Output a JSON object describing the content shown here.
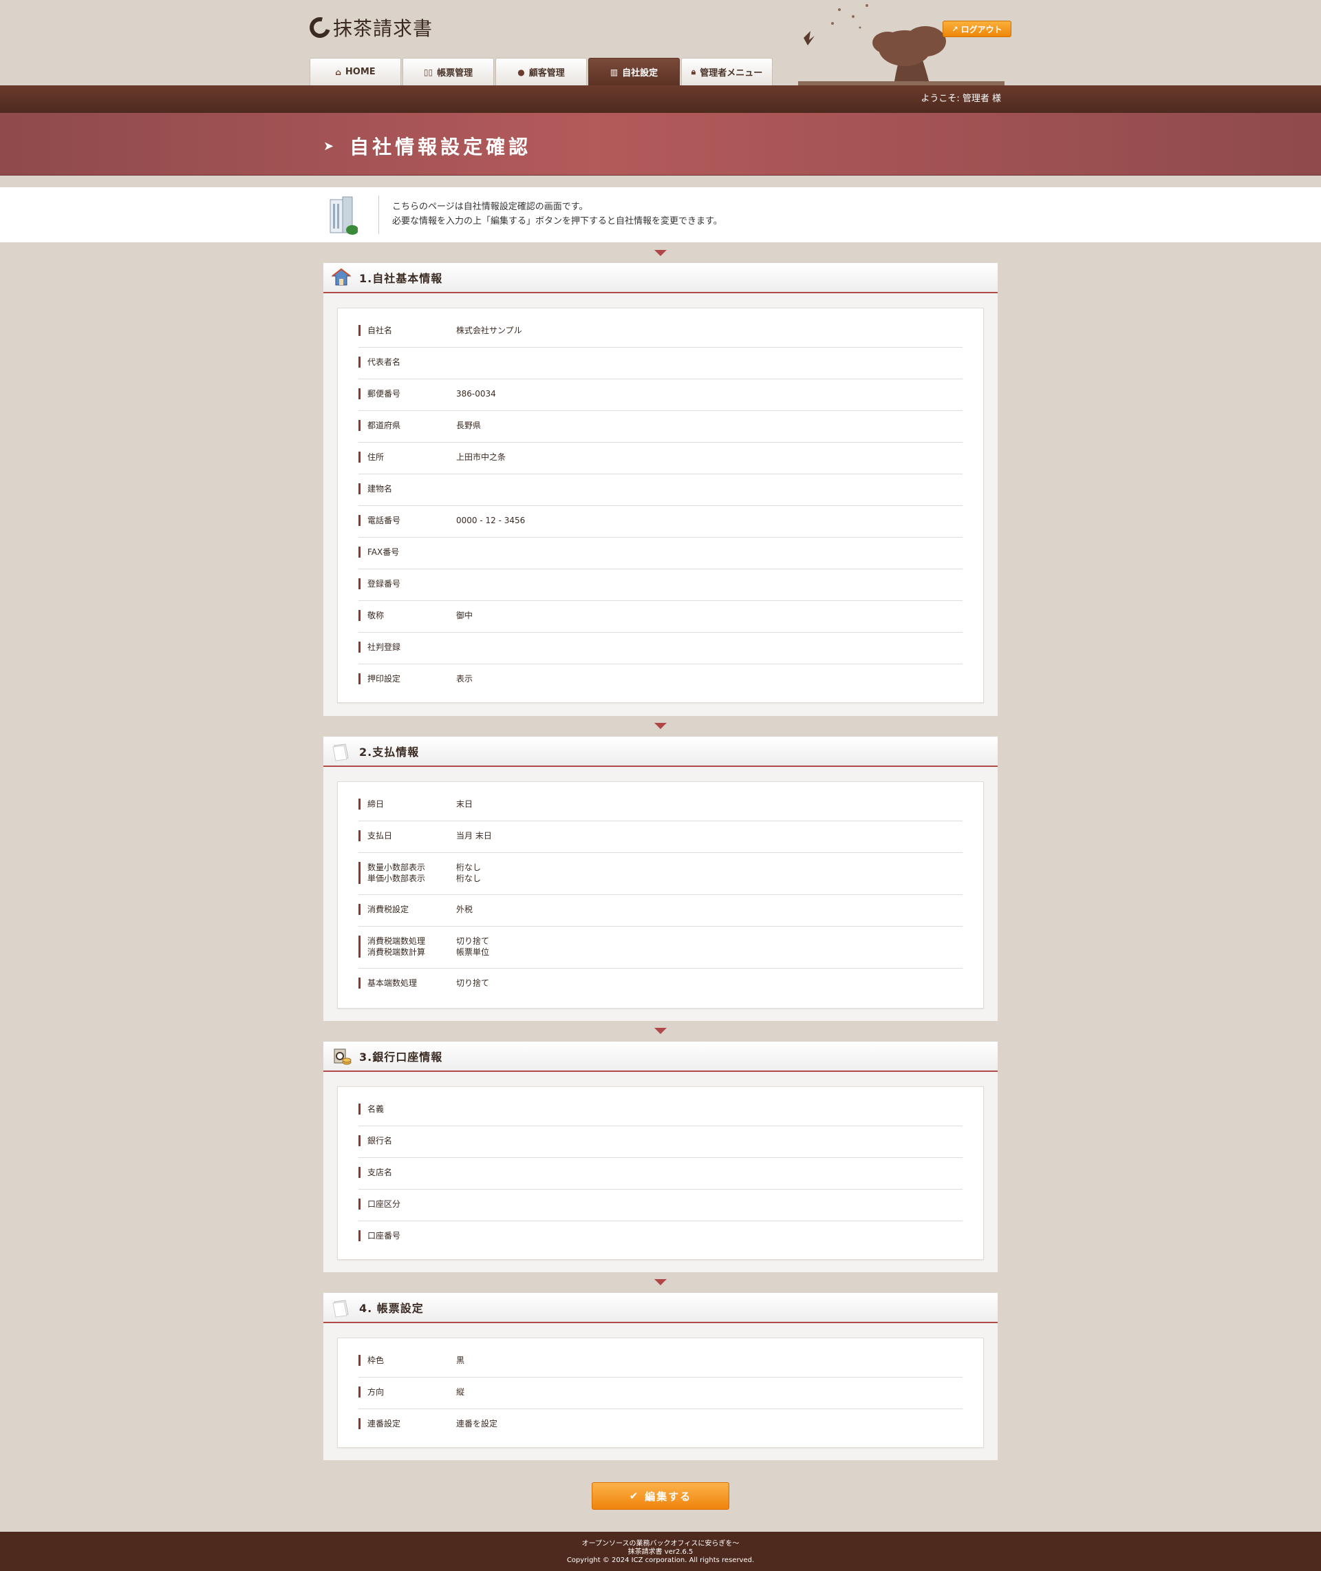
{
  "header": {
    "logo_text": "抹茶請求書",
    "logout_label": "ログアウト",
    "tabs": [
      {
        "label": "HOME",
        "icon": "home-icon",
        "active": false
      },
      {
        "label": "帳票管理",
        "icon": "book-icon",
        "active": false
      },
      {
        "label": "顧客管理",
        "icon": "person-icon",
        "active": false
      },
      {
        "label": "自社設定",
        "icon": "building-icon",
        "active": true
      },
      {
        "label": "管理者メニュー",
        "icon": "lock-icon",
        "active": false
      }
    ],
    "welcome": "ようこそ: 管理者 様"
  },
  "banner": {
    "title": "自社情報設定確認"
  },
  "intro": {
    "line1": "こちらのページは自社情報設定確認の画面です。",
    "line2": "必要な情報を入力の上「編集する」ボタンを押下すると自社情報を変更できます。"
  },
  "sections": [
    {
      "title": "1.自社基本情報",
      "icon": "house-icon",
      "rows": [
        {
          "label": "自社名",
          "value": "株式会社サンプル"
        },
        {
          "label": "代表者名",
          "value": ""
        },
        {
          "label": "郵便番号",
          "value": "386-0034"
        },
        {
          "label": "都道府県",
          "value": "長野県"
        },
        {
          "label": "住所",
          "value": "上田市中之条"
        },
        {
          "label": "建物名",
          "value": ""
        },
        {
          "label": "電話番号",
          "value": "0000 - 12 - 3456"
        },
        {
          "label": "FAX番号",
          "value": ""
        },
        {
          "label": "登録番号",
          "value": ""
        },
        {
          "label": "敬称",
          "value": "御中"
        },
        {
          "label": "社判登録",
          "value": ""
        },
        {
          "label": "押印設定",
          "value": "表示"
        }
      ]
    },
    {
      "title": "2.支払情報",
      "icon": "paper-icon",
      "rows": [
        {
          "label": "締日",
          "value": "末日"
        },
        {
          "label": "支払日",
          "value": "当月 末日"
        },
        {
          "label": "数量小数部表示\n単価小数部表示",
          "value": "桁なし\n桁なし"
        },
        {
          "label": "消費税設定",
          "value": "外税"
        },
        {
          "label": "消費税端数処理\n消費税端数計算",
          "value": "切り捨て\n帳票単位"
        },
        {
          "label": "基本端数処理",
          "value": "切り捨て"
        }
      ]
    },
    {
      "title": "3.銀行口座情報",
      "icon": "bank-icon",
      "rows": [
        {
          "label": "名義",
          "value": ""
        },
        {
          "label": "銀行名",
          "value": ""
        },
        {
          "label": "支店名",
          "value": ""
        },
        {
          "label": "口座区分",
          "value": ""
        },
        {
          "label": "口座番号",
          "value": ""
        }
      ]
    },
    {
      "title": "4. 帳票設定",
      "icon": "paper-icon",
      "rows": [
        {
          "label": "枠色",
          "value": "黒"
        },
        {
          "label": "方向",
          "value": "縦"
        },
        {
          "label": "連番設定",
          "value": "連番を設定"
        }
      ]
    }
  ],
  "edit_button_label": "編集する",
  "footer": {
    "line1": "オープンソースの業務バックオフィスに安らぎを〜",
    "line2": "抹茶請求書 ver2.6.5",
    "line3": "Copyright © 2024 ICZ corporation. All rights reserved."
  },
  "colors": {
    "accent_brown": "#4e2a1e",
    "banner_red": "#b35a5b",
    "button_orange": "#ef840c",
    "page_bg": "#dcd4ca"
  }
}
